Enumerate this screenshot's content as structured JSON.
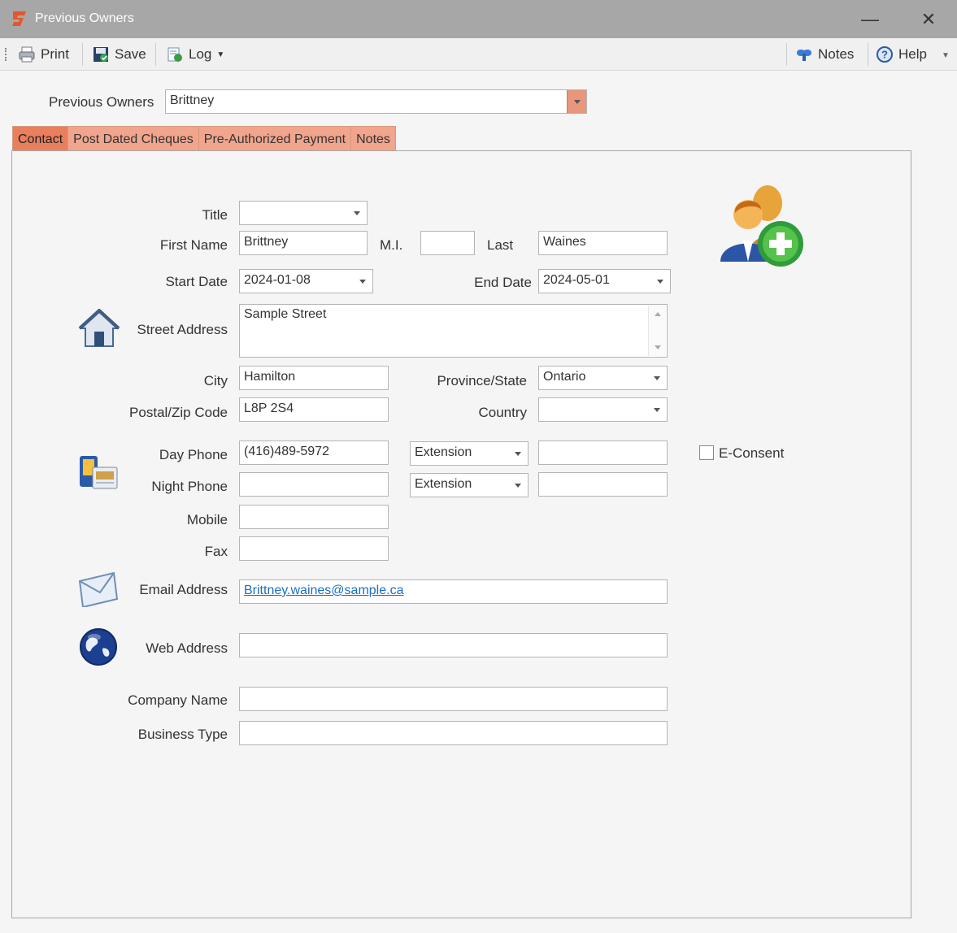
{
  "window": {
    "title": "Previous Owners",
    "minimize": "—",
    "close": "✕"
  },
  "toolbar": {
    "print": "Print",
    "save": "Save",
    "log": "Log",
    "notes": "Notes",
    "help": "Help"
  },
  "owner_select": {
    "label": "Previous Owners",
    "value": "Brittney"
  },
  "tabs": [
    {
      "label": "Contact",
      "active": true
    },
    {
      "label": "Post Dated Cheques",
      "active": false
    },
    {
      "label": "Pre-Authorized Payment",
      "active": false
    },
    {
      "label": "Notes",
      "active": false
    }
  ],
  "form": {
    "title": {
      "label": "Title",
      "value": ""
    },
    "first_name": {
      "label": "First Name",
      "value": "Brittney"
    },
    "mi": {
      "label": "M.I.",
      "value": ""
    },
    "last": {
      "label": "Last",
      "value": "Waines"
    },
    "start_date": {
      "label": "Start Date",
      "value": "2024-01-08"
    },
    "end_date": {
      "label": "End Date",
      "value": "2024-05-01"
    },
    "street_address": {
      "label": "Street Address",
      "value": "Sample Street"
    },
    "city": {
      "label": "City",
      "value": "Hamilton"
    },
    "province": {
      "label": "Province/State",
      "value": "Ontario"
    },
    "postal": {
      "label": "Postal/Zip Code",
      "value": "L8P 2S4"
    },
    "country": {
      "label": "Country",
      "value": ""
    },
    "day_phone": {
      "label": "Day Phone",
      "value": "(416)489-5972",
      "ext_type": "Extension",
      "ext_value": ""
    },
    "night_phone": {
      "label": "Night Phone",
      "value": "",
      "ext_type": "Extension",
      "ext_value": ""
    },
    "econsent": {
      "label": "E-Consent",
      "checked": false
    },
    "mobile": {
      "label": "Mobile",
      "value": ""
    },
    "fax": {
      "label": "Fax",
      "value": ""
    },
    "email": {
      "label": "Email Address",
      "value": "Brittney.waines@sample.ca"
    },
    "web": {
      "label": "Web Address",
      "value": ""
    },
    "company": {
      "label": "Company Name",
      "value": ""
    },
    "business_type": {
      "label": "Business Type",
      "value": ""
    }
  },
  "icons": {
    "app": "app-logo-icon",
    "print": "printer-icon",
    "save": "floppy-disk-icon",
    "log": "log-icon",
    "notes": "notes-icon",
    "help": "help-icon",
    "add_contact": "add-contact-icon",
    "house": "house-icon",
    "phone": "phone-icon",
    "envelope": "envelope-icon",
    "globe": "globe-icon"
  },
  "colors": {
    "accent": "#e97f5d",
    "tab": "#f1a58d",
    "titlebar": "#a7a7a7",
    "link": "#1a6fc4"
  }
}
